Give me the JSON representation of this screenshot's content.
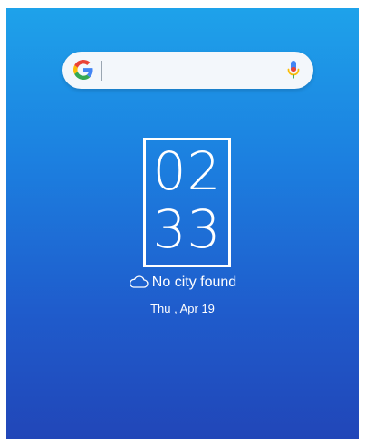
{
  "search_widget": {
    "logo_icon": "google-g-icon",
    "mic_icon": "microphone-icon"
  },
  "clock": {
    "hours": "02",
    "minutes": "33"
  },
  "weather": {
    "icon": "cloud-icon",
    "text": "No city found"
  },
  "date": {
    "text": "Thu , Apr 19"
  },
  "colors": {
    "gradient_top": "#1ea2ea",
    "gradient_bottom": "#2146b8",
    "google_blue": "#4285F4",
    "google_red": "#EA4335",
    "google_yellow": "#FBBC05",
    "google_green": "#34A853"
  }
}
